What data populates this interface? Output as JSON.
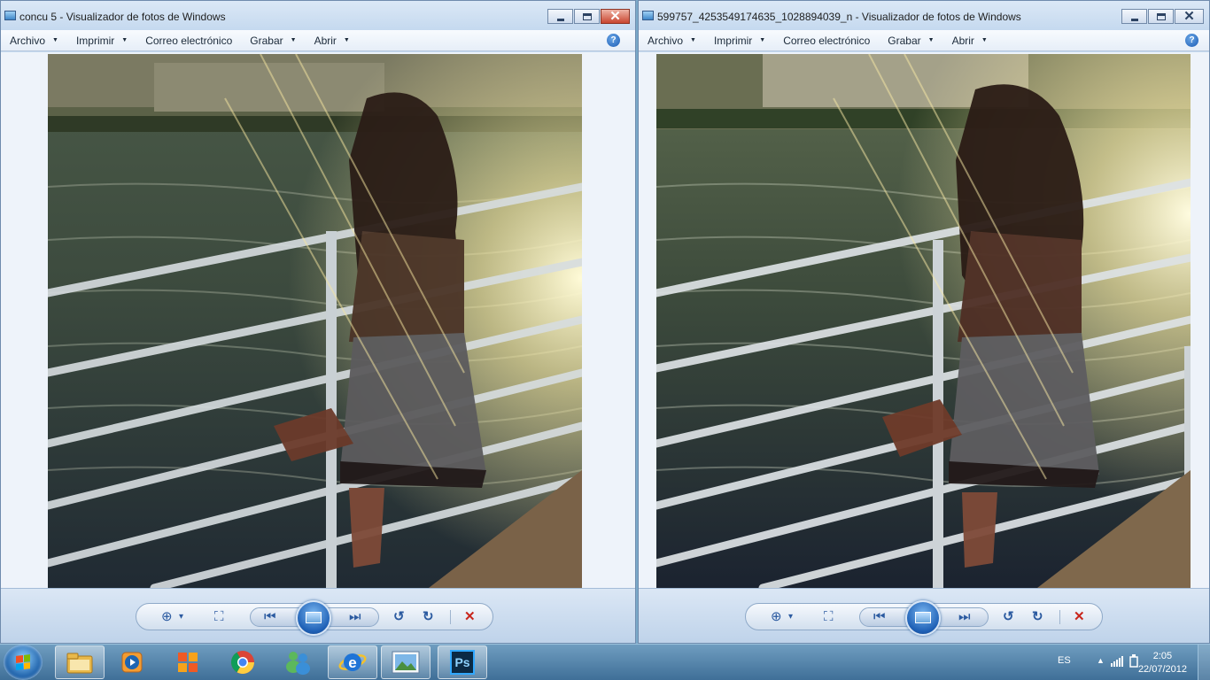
{
  "windows": [
    {
      "title": "concu 5 - Visualizador de fotos de Windows",
      "menu": [
        {
          "label": "Archivo",
          "dropdown": true
        },
        {
          "label": "Imprimir",
          "dropdown": true
        },
        {
          "label": "Correo electrónico",
          "dropdown": false
        },
        {
          "label": "Grabar",
          "dropdown": true
        },
        {
          "label": "Abrir",
          "dropdown": true
        }
      ],
      "active": true
    },
    {
      "title": "599757_4253549174635_1028894039_n - Visualizador de fotos de Windows",
      "menu": [
        {
          "label": "Archivo",
          "dropdown": true
        },
        {
          "label": "Imprimir",
          "dropdown": true
        },
        {
          "label": "Correo electrónico",
          "dropdown": false
        },
        {
          "label": "Grabar",
          "dropdown": true
        },
        {
          "label": "Abrir",
          "dropdown": true
        }
      ],
      "active": false
    }
  ],
  "glyphs": {
    "dropdown_arrow": "▼",
    "help": "?",
    "close": "✕",
    "zoom": "⊕",
    "zoom_arrow": "▾",
    "fit": "⛶",
    "previous": "⏮",
    "next": "⏭",
    "rotate_ccw": "↺",
    "rotate_cw": "↻",
    "delete": "✕"
  },
  "taskbar": {
    "apps": [
      {
        "name": "explorer",
        "icon": "folder-icon",
        "active": true
      },
      {
        "name": "media-player",
        "icon": "media-player-icon",
        "active": false
      },
      {
        "name": "office",
        "icon": "office-icon",
        "active": false
      },
      {
        "name": "chrome",
        "icon": "chrome-icon",
        "active": false
      },
      {
        "name": "messenger",
        "icon": "messenger-icon",
        "active": false
      },
      {
        "name": "internet-explorer",
        "icon": "ie-icon",
        "active": true
      },
      {
        "name": "photo-viewer",
        "icon": "photo-viewer-icon",
        "active": true
      },
      {
        "name": "photoshop",
        "icon": "photoshop-icon",
        "active": true
      }
    ],
    "photoshop_label": "Ps",
    "ie_label": "e",
    "language": "ES",
    "time": "2:05",
    "date": "22/07/2012"
  },
  "colors": {
    "accent_close": "#c9452f",
    "nav_blue": "#2b5aa0",
    "delete_red": "#c8261c"
  }
}
